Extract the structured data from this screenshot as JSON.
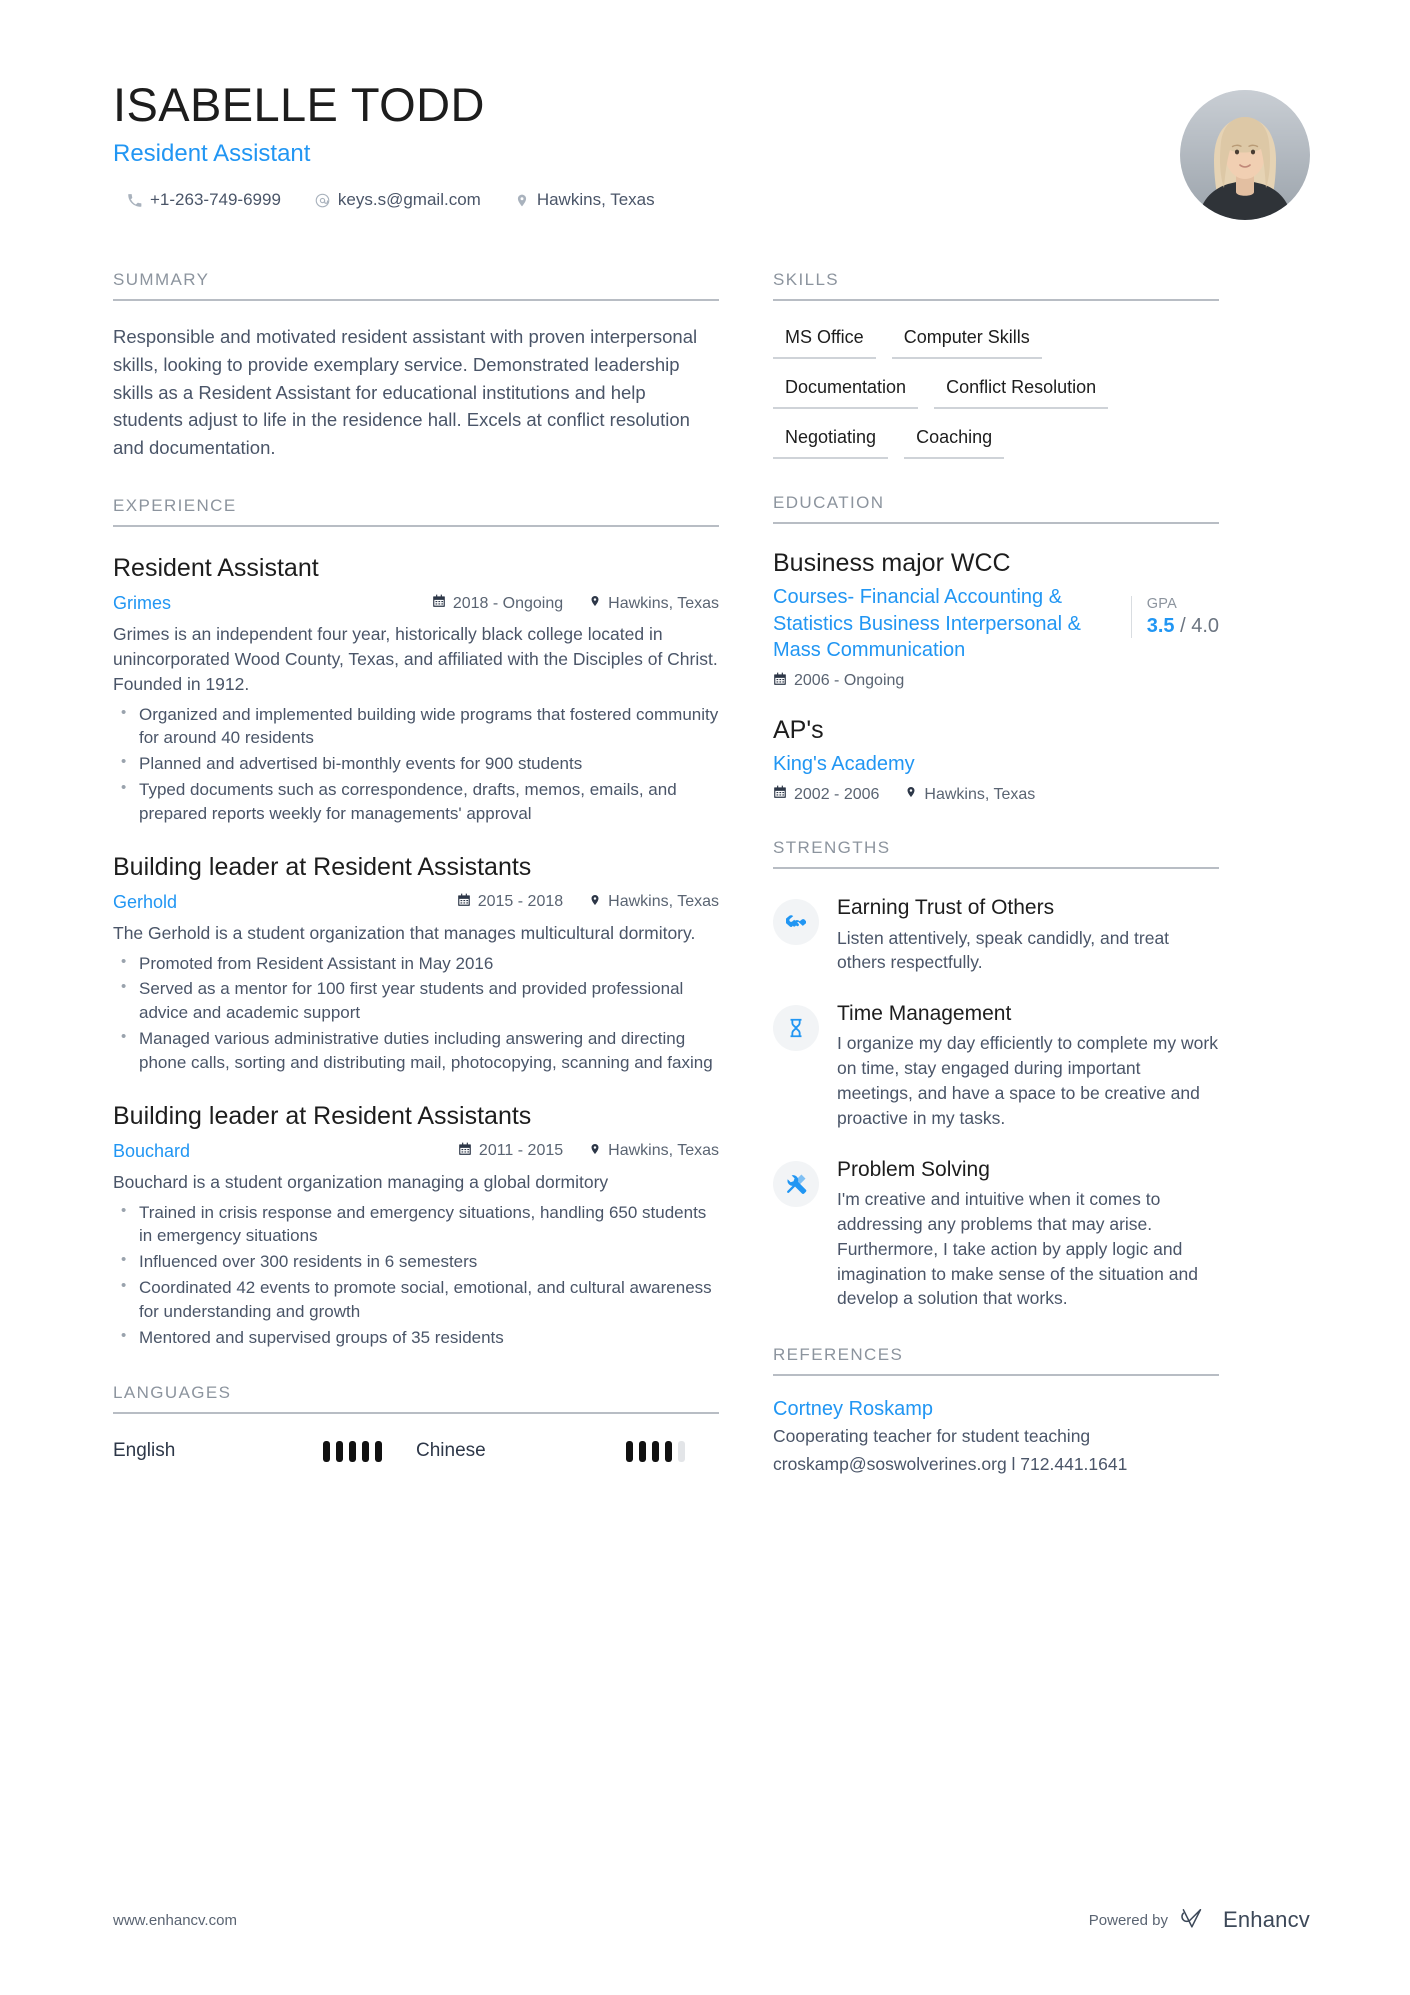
{
  "header": {
    "name": "ISABELLE TODD",
    "job_title": "Resident Assistant",
    "contacts": [
      {
        "icon": "phone-icon",
        "text": "+1-263-749-6999"
      },
      {
        "icon": "email-icon",
        "text": "keys.s@gmail.com"
      },
      {
        "icon": "location-pin-icon",
        "text": "Hawkins, Texas"
      }
    ]
  },
  "summary": {
    "title": "SUMMARY",
    "text": "Responsible and motivated resident assistant with proven interpersonal skills, looking to provide exemplary service. Demonstrated leadership skills as a Resident Assistant for educational institutions and help students adjust to life in the residence hall. Excels at conflict resolution and documentation."
  },
  "experience": {
    "title": "EXPERIENCE",
    "items": [
      {
        "role": "Resident Assistant",
        "company": "Grimes",
        "date": "2018 - Ongoing",
        "location": "Hawkins, Texas",
        "description": "Grimes is an independent four year, historically black college located in unincorporated Wood County, Texas, and affiliated with the Disciples of Christ. Founded in 1912.",
        "bullets": [
          "Organized and implemented building wide programs that fostered community for around 40 residents",
          "Planned and advertised bi-monthly events for 900 students",
          "Typed documents such as correspondence, drafts, memos, emails, and prepared reports weekly for managements' approval"
        ]
      },
      {
        "role": "Building leader at Resident Assistants",
        "company": "Gerhold",
        "date": "2015 - 2018",
        "location": "Hawkins, Texas",
        "description": "The Gerhold is a student organization that manages multicultural dormitory.",
        "bullets": [
          "Promoted from Resident Assistant in May 2016",
          "Served as a mentor for 100 first year students and provided professional advice and academic support",
          "Managed various administrative duties including answering and directing phone calls, sorting and distributing mail, photocopying, scanning and faxing"
        ]
      },
      {
        "role": "Building leader at Resident Assistants",
        "company": "Bouchard",
        "date": "2011 - 2015",
        "location": "Hawkins, Texas",
        "description": "Bouchard is a student organization managing a global dormitory",
        "bullets": [
          "Trained in crisis response and emergency situations, handling 650 students in emergency situations",
          "Influenced over 300 residents in 6 semesters",
          "Coordinated 42 events to promote social, emotional, and cultural awareness for understanding and growth",
          "Mentored and supervised groups of 35 residents"
        ]
      }
    ]
  },
  "languages": {
    "title": "LANGUAGES",
    "items": [
      {
        "name": "English",
        "level": 5,
        "max": 5
      },
      {
        "name": "Chinese",
        "level": 4,
        "max": 5
      }
    ]
  },
  "skills": {
    "title": "SKILLS",
    "rows": [
      [
        "MS Office",
        "Computer Skills"
      ],
      [
        "Documentation",
        "Conflict Resolution"
      ],
      [
        "Negotiating",
        "Coaching"
      ]
    ]
  },
  "education": {
    "title": "EDUCATION",
    "items": [
      {
        "school": "Business major WCC",
        "course": "Courses- Financial Accounting & Statistics Business  Interpersonal & Mass Communication",
        "date": "2006 - Ongoing",
        "location": "",
        "gpa_label": "GPA",
        "gpa_value": "3.5",
        "gpa_scale": "/ 4.0"
      },
      {
        "school": "AP's",
        "course": "King's Academy",
        "date": "2002 - 2006",
        "location": "Hawkins, Texas",
        "gpa_label": "",
        "gpa_value": "",
        "gpa_scale": ""
      }
    ]
  },
  "strengths": {
    "title": "STRENGTHS",
    "items": [
      {
        "icon": "handshake-icon",
        "title": "Earning Trust of Others",
        "text": "Listen attentively, speak candidly, and treat others respectfully."
      },
      {
        "icon": "hourglass-icon",
        "title": "Time Management",
        "text": "I organize my day efficiently to complete my work on time, stay engaged during important meetings, and have a space to be creative and proactive in my tasks."
      },
      {
        "icon": "tools-icon",
        "title": "Problem Solving",
        "text": "I'm creative and intuitive when it comes to addressing any problems that may arise. Furthermore, I take action by apply logic and imagination to make sense of the situation and develop a solution that works."
      }
    ]
  },
  "references": {
    "title": "REFERENCES",
    "name": "Cortney Roskamp",
    "role": "Cooperating teacher for student teaching",
    "contact": "croskamp@soswolverines.org l 712.441.1641"
  },
  "footer": {
    "website": "www.enhancv.com",
    "powered_by": "Powered by",
    "brand": "Enhancv"
  },
  "colors": {
    "accent": "#2196f3",
    "text": "#4a5568",
    "heading": "#8c949e"
  }
}
